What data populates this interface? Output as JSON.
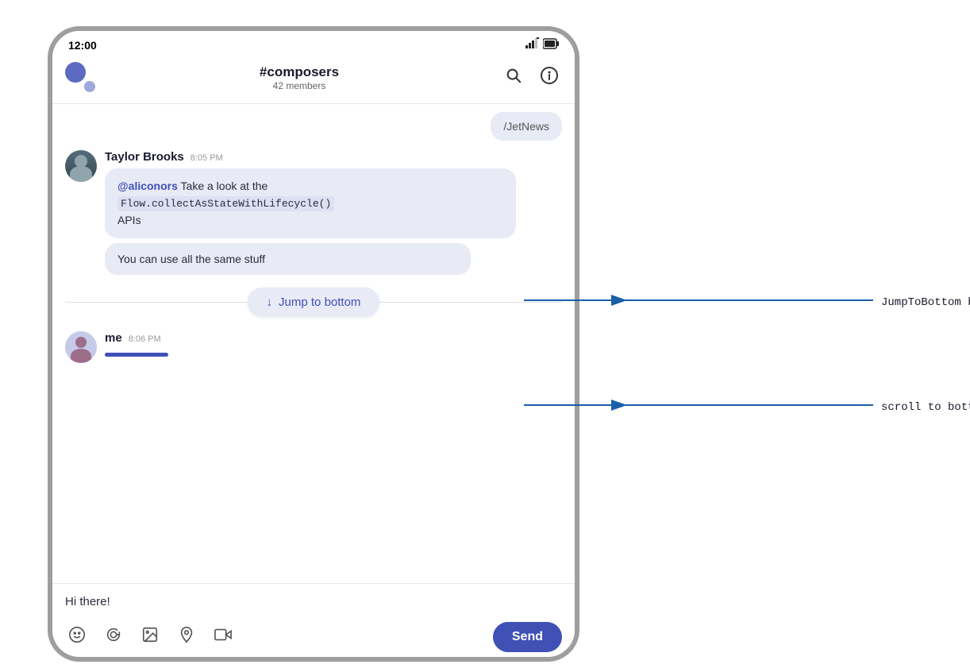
{
  "status_bar": {
    "time": "12:00",
    "signal_icon": "signal",
    "battery_icon": "battery"
  },
  "header": {
    "channel": "#composers",
    "members": "42 members",
    "search_label": "search",
    "info_label": "info"
  },
  "chat": {
    "previous_snippet": "/JetNews",
    "taylor_message": {
      "sender": "Taylor Brooks",
      "time": "8:05 PM",
      "mention": "@aliconors",
      "text1": " Take a look at the",
      "code": "Flow.collectAsStateWithLifecycle()",
      "text2": "APIs",
      "bubble2": "You can use all the same stuff"
    },
    "jump_button": {
      "arrow": "↓",
      "label": "Jump to bottom"
    },
    "me_message": {
      "sender": "me",
      "time": "8:06 PM",
      "input_text": "Hi there!"
    }
  },
  "toolbar": {
    "emoji_icon": "😊",
    "mention_icon": "@",
    "image_icon": "🖼",
    "location_icon": "📍",
    "video_icon": "📷",
    "send_label": "Send"
  },
  "annotations": {
    "jump_label": "JumpToBottom button",
    "scroll_label": "scroll to bottom on new messages"
  }
}
